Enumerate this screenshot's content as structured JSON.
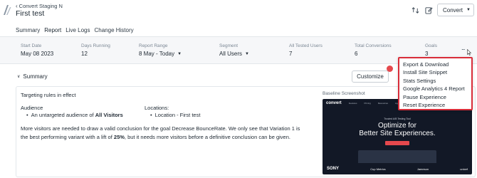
{
  "header": {
    "back_label": "Convert Staging N",
    "title": "First test",
    "convert_button": "Convert"
  },
  "tabs": [
    {
      "label": "Summary",
      "active": false
    },
    {
      "label": "Report",
      "active": true
    },
    {
      "label": "Live Logs",
      "active": false
    },
    {
      "label": "Change History",
      "active": false
    }
  ],
  "stats": {
    "start_date": {
      "label": "Start Date",
      "value": "May 08 2023"
    },
    "days_running": {
      "label": "Days Running",
      "value": "12"
    },
    "report_range": {
      "label": "Report Range",
      "value": "8 May - Today"
    },
    "segment": {
      "label": "Segment",
      "value": "All Users"
    },
    "all_tested_users": {
      "label": "All Tested Users",
      "value": "7"
    },
    "total_conversions": {
      "label": "Total Conversions",
      "value": "6"
    },
    "goals": {
      "label": "Goals",
      "value": "3"
    },
    "more": "..."
  },
  "summary": {
    "toggle_label": "Summary",
    "customize_label": "Customize",
    "targeting_heading": "Targeting rules in effect",
    "audience_heading": "Audience",
    "audience_prefix": "An untargeted audience of",
    "audience_bold": "All Visitors",
    "locations_heading": "Locations:",
    "location_value": "Location - First test",
    "conclusion_part1": "More visitors are needed to draw a valid conclusion for the goal Decrease BounceRate. We only see that Variation 1 is the best performing variant with a lift of",
    "conclusion_lift": "25%",
    "conclusion_part2": ", but it needs more visitors before a definitive conclusion can be given.",
    "baseline_label": "Baseline Screenshot"
  },
  "baseline_preview": {
    "logo": "convert",
    "nav_items": [
      "Features",
      "Pricing",
      "Resources",
      "Agencies",
      "Company"
    ],
    "kicker": "Trusted A/B Testing Tool",
    "headline_line1": "Optimize for",
    "headline_line2": "Better Site Experiences.",
    "brands": [
      "SONY",
      "Cup Metrics",
      "Jameson",
      "unicef"
    ]
  },
  "dropdown": {
    "items": [
      "Export & Download",
      "Install Site Snippet",
      "Stats Settings",
      "Google Analytics 4 Report",
      "Pause Experience",
      "Reset Experience"
    ]
  },
  "colors": {
    "accent": "#2b5fd9",
    "highlight": "#d92d3a",
    "notification_dot": "#e5484d"
  }
}
